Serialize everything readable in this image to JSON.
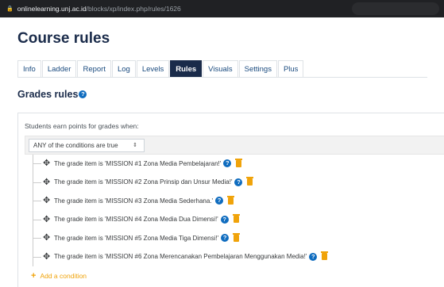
{
  "browser": {
    "host": "onlinelearning.unj.ac.id",
    "path": "/blocks/xp/index.php/rules/1626"
  },
  "page": {
    "title": "Course rules"
  },
  "tabs": [
    {
      "label": "Info"
    },
    {
      "label": "Ladder"
    },
    {
      "label": "Report"
    },
    {
      "label": "Log"
    },
    {
      "label": "Levels"
    },
    {
      "label": "Rules",
      "active": true
    },
    {
      "label": "Visuals"
    },
    {
      "label": "Settings"
    },
    {
      "label": "Plus"
    }
  ],
  "section": {
    "title": "Grades rules"
  },
  "panel": {
    "intro": "Students earn points for grades when:",
    "condition_select": "ANY of the conditions are true",
    "rules": [
      {
        "text": "The grade item is 'MISSION #1 Zona Media Pembelajaran!'"
      },
      {
        "text": "The grade item is 'MISSION #2 Zona Prinsip dan Unsur Media!'"
      },
      {
        "text": "The grade item is 'MISSION #3 Zona Media Sederhana.'"
      },
      {
        "text": "The grade item is 'MISSION #4 Zona Media Dua Dimensi!'"
      },
      {
        "text": "The grade item is 'MISSION #5 Zona Media Tiga Dimensi!'"
      },
      {
        "text": "The grade item is 'MISSION #6 Zona Merencanakan Pembelajaran Menggunakan Media!'"
      }
    ],
    "add_label": "Add a condition"
  },
  "colors": {
    "accent": "#1a2b4a",
    "link": "#1a4b7f",
    "help": "#0f6cbf",
    "warning": "#f0a30a"
  }
}
